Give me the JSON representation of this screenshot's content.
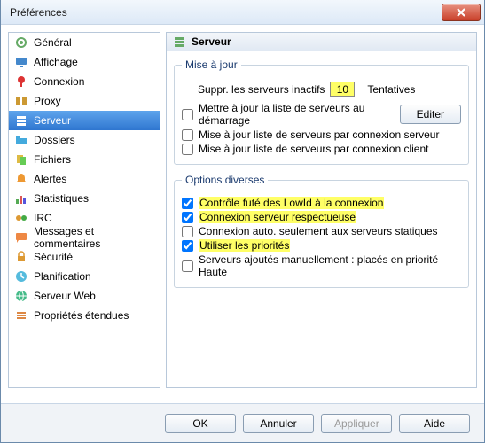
{
  "titlebar": {
    "title": "Préférences"
  },
  "sidebar": {
    "items": [
      {
        "label": "Général"
      },
      {
        "label": "Affichage"
      },
      {
        "label": "Connexion"
      },
      {
        "label": "Proxy"
      },
      {
        "label": "Serveur"
      },
      {
        "label": "Dossiers"
      },
      {
        "label": "Fichiers"
      },
      {
        "label": "Alertes"
      },
      {
        "label": "Statistiques"
      },
      {
        "label": "IRC"
      },
      {
        "label": "Messages et commentaires"
      },
      {
        "label": "Sécurité"
      },
      {
        "label": "Planification"
      },
      {
        "label": "Serveur Web"
      },
      {
        "label": "Propriétés étendues"
      }
    ]
  },
  "main": {
    "title": "Serveur",
    "update": {
      "legend": "Mise à jour",
      "suppr_label": "Suppr. les serveurs inactifs",
      "suppr_value": "10",
      "tentatives": "Tentatives",
      "editer": "Editer",
      "cb1": "Mettre à jour la liste de serveurs au démarrage",
      "cb2": "Mise à jour liste de serveurs par connexion serveur",
      "cb3": "Mise à jour liste de serveurs par connexion client"
    },
    "options": {
      "legend": "Options diverses",
      "cb1": "Contrôle futé des LowId à la connexion",
      "cb2": "Connexion serveur respectueuse",
      "cb3": "Connexion auto. seulement aux serveurs statiques",
      "cb4": "Utiliser les priorités",
      "cb5": "Serveurs ajoutés manuellement : placés en priorité Haute"
    }
  },
  "footer": {
    "ok": "OK",
    "cancel": "Annuler",
    "apply": "Appliquer",
    "help": "Aide"
  }
}
